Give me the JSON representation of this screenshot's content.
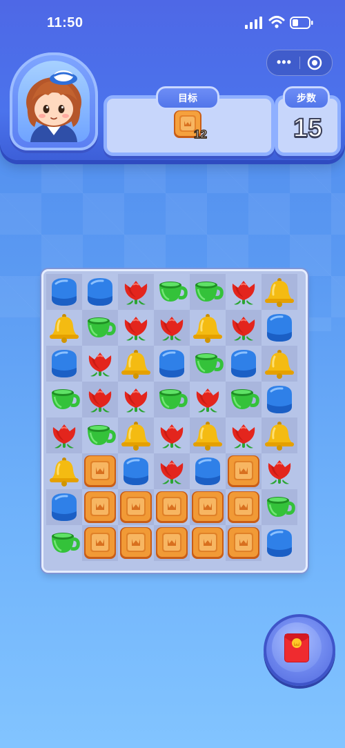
{
  "status_bar": {
    "time": "11:50"
  },
  "header": {
    "goal_label": "目标",
    "goal_count": "12",
    "steps_label": "步数",
    "steps_value": "15"
  },
  "capsule": {
    "more": "•••"
  },
  "board": {
    "rows": 8,
    "cols": 7,
    "grid": [
      [
        "blue",
        "blue",
        "tulip",
        "cup",
        "cup",
        "tulip",
        "bell"
      ],
      [
        "bell",
        "cup",
        "tulip",
        "tulip",
        "bell",
        "tulip",
        "blue"
      ],
      [
        "blue",
        "tulip",
        "bell",
        "blue",
        "cup",
        "blue",
        "bell"
      ],
      [
        "cup",
        "tulip",
        "tulip",
        "cup",
        "tulip",
        "cup",
        "blue"
      ],
      [
        "tulip",
        "cup",
        "bell",
        "tulip",
        "bell",
        "tulip",
        "bell"
      ],
      [
        "bell",
        "crate",
        "blue",
        "tulip",
        "blue",
        "crate",
        "tulip"
      ],
      [
        "blue",
        "crate",
        "crate",
        "crate",
        "crate",
        "crate",
        "cup"
      ],
      [
        "cup",
        "crate",
        "crate",
        "crate",
        "crate",
        "crate",
        "blue"
      ]
    ]
  },
  "icons": {
    "goal": "crate-icon",
    "bonus": "red-envelope-icon",
    "avatar": "girl-avatar-icon"
  },
  "colors": {
    "header": "#4b73ec",
    "board": "#b6c4e8",
    "tulip": "#e3251d",
    "cup": "#34c23a",
    "bell": "#f4bb12",
    "blue_piece": "#2f80e8",
    "crate": "#f19a36"
  }
}
